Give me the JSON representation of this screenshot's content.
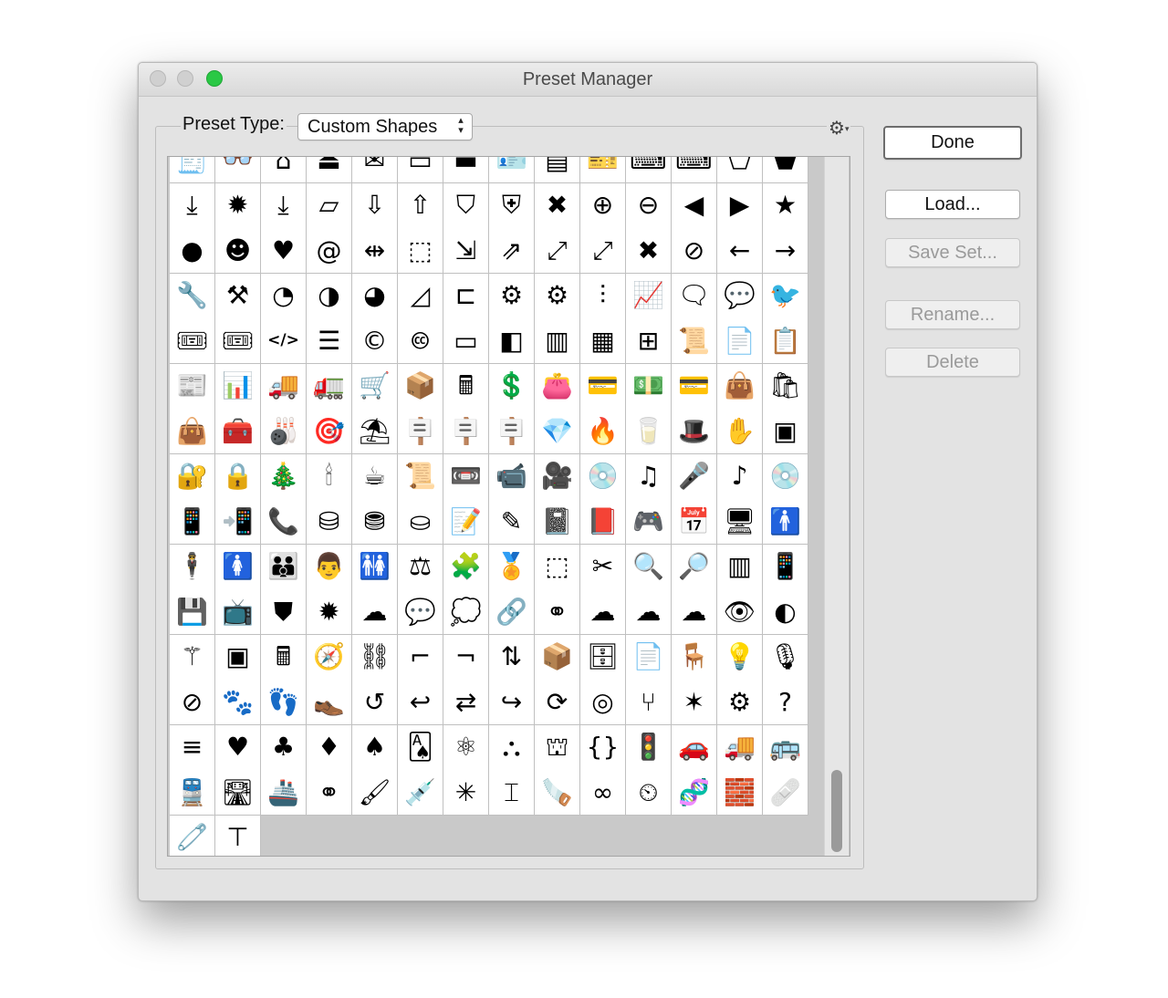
{
  "window": {
    "title": "Preset Manager"
  },
  "preset_type": {
    "label": "Preset Type:",
    "value": "Custom Shapes"
  },
  "gear": {
    "symbol": "⚙"
  },
  "buttons": {
    "done": "Done",
    "load": "Load...",
    "save_set": "Save Set...",
    "rename": "Rename...",
    "delete": "Delete"
  },
  "shapes": [
    "receipt",
    "goggles",
    "hanger",
    "user-tray",
    "mail-open",
    "inbox",
    "inbox-dark",
    "id-card",
    "certificate",
    "tickets",
    "keyboard",
    "keyboard-2",
    "tag",
    "tag-dark",
    "download-tray",
    "download-badge",
    "download-line",
    "inbox-outline",
    "inbox-download",
    "inbox-upload",
    "shield-half",
    "shield-star",
    "close-circle",
    "plus-circle",
    "minus-circle",
    "back-circle",
    "play-circle",
    "star-circle",
    "new-badge",
    "user-circle",
    "heart-bubble",
    "at-bubble",
    "resize-horizontal",
    "shrink-dashed",
    "shrink-box",
    "external-link",
    "expand-diagonal",
    "expand-box",
    "x-mark",
    "no-sign",
    "arrow-left",
    "arrow-right",
    "wrench",
    "tools",
    "gauge-low",
    "gauge-mid",
    "gauge-high",
    "ruler-triangle",
    "link-box",
    "gear-big",
    "gears",
    "sliders",
    "line-chart",
    "speech-bubble",
    "speech-bubble-dark",
    "bird-bubble",
    "ticket",
    "ticket-2",
    "code-tag",
    "stack-document",
    "copyright",
    "creative-commons",
    "browser-www",
    "layout-sidebar",
    "layout-columns",
    "layout-grid",
    "layout-dashboard",
    "scroll-curl",
    "price-list",
    "invoice",
    "newspaper-chart",
    "presentation",
    "delivery-truck",
    "fast-delivery",
    "hand-truck",
    "package",
    "cash-register",
    "receipt-dollar",
    "wallet",
    "wallet-cards",
    "wallet-cash",
    "atm-card",
    "shopping-bag-dollar",
    "shopping-bag-tag",
    "handbag",
    "toolbox",
    "bowling",
    "target",
    "beach",
    "sign-open",
    "sign-closed",
    "sign-24-7",
    "diamond",
    "flame",
    "glass",
    "hat",
    "stop-hand",
    "safe",
    "padlock-dial",
    "padlock",
    "christmas-tree",
    "candle",
    "coffee-cup",
    "paper-scroll",
    "cassette",
    "video-camera",
    "hd-camera",
    "vinyl-record",
    "music-note",
    "microphone",
    "music-list",
    "disc",
    "phone-chat",
    "phone-sms",
    "phone-call",
    "database",
    "database-raid",
    "database-network",
    "edit-document",
    "edit-pencil",
    "notebook",
    "book-dark",
    "gamepad",
    "calendar-clock",
    "devices",
    "man",
    "businessman",
    "woman",
    "team",
    "family",
    "man-wc",
    "scales",
    "puzzle-piece",
    "medal",
    "dashed-square",
    "discount-cut",
    "barcode-search",
    "qr-search",
    "barcode-scanner",
    "smartphone",
    "sd-card",
    "retro-tv",
    "banner-shield",
    "badge-seal",
    "cloud-dark",
    "chat-bubble",
    "chat-heart",
    "chain-link",
    "network-nodes",
    "cloud-sync",
    "cloud-upload",
    "cloud-delete",
    "eye",
    "half-circle",
    "magic-wand",
    "cpu-64",
    "calculator",
    "compass",
    "link-horizontal",
    "stairs-up",
    "stairs-down",
    "elevator",
    "open-box",
    "filing-cabinet",
    "document-dots",
    "office-desk",
    "desk-lamp",
    "microphone-stand",
    "hearing-off",
    "paw-print",
    "footprint",
    "shoe-prints",
    "undo-circle",
    "undo",
    "swap-arrows",
    "share-out",
    "refresh-rotate",
    "binoculars",
    "split-arrows",
    "sheriff-star",
    "head-gear",
    "head-question",
    "abacus",
    "card-hearts",
    "card-clubs",
    "card-diamonds",
    "card-spades",
    "cards-ace",
    "molecule",
    "org-chart",
    "hierarchy",
    "curly-brackets",
    "traffic-light",
    "car",
    "truck",
    "bus",
    "train",
    "road",
    "ship",
    "venn-diagram",
    "paint-brush",
    "pipette",
    "laser",
    "corkscrew",
    "hand-saw",
    "infinity",
    "hours-24",
    "dna",
    "toy-brick",
    "bandage",
    "safety-pin",
    "tool-t"
  ]
}
